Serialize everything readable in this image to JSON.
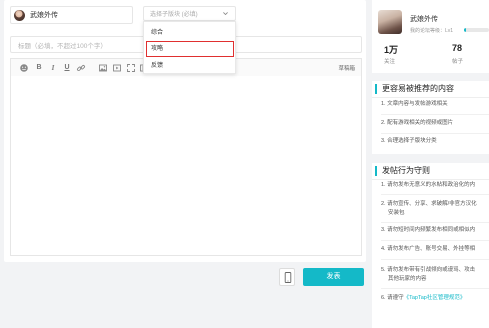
{
  "editor": {
    "forum_name": "武娘外传",
    "section_select": {
      "placeholder": "选择子版块 (必填)",
      "options": [
        "综合",
        "攻略",
        "反馈"
      ],
      "highlighted_option": "攻略"
    },
    "title_placeholder": "标题（必填，不超过100个字）",
    "toolbar": {
      "bold_label": "B",
      "italic_label": "I",
      "underline_label": "U",
      "draft_label": "草稿箱"
    },
    "publish_label": "发表"
  },
  "profile": {
    "name": "武娘外传",
    "level_text": "我的论坛等级：Lv1",
    "level_progress_percent": 8,
    "stats": [
      {
        "value": "1万",
        "label": "关注"
      },
      {
        "value": "78",
        "label": "帖子"
      }
    ]
  },
  "recommend": {
    "title": "更容易被推荐的内容",
    "tips": [
      "1. 文章内容与发帖游戏相关",
      "2. 配有游戏相关的视频或图片",
      "3. 合理选择子版块分类"
    ]
  },
  "rules": {
    "title": "发帖行为守则",
    "tips": [
      {
        "lines": [
          "1. 请勿发布无意义的水帖和政治化的内"
        ]
      },
      {
        "lines": [
          "2. 请勿宣传、分享、求破解/非官方汉化",
          "安装包"
        ]
      },
      {
        "lines": [
          "3. 请勿短时间内频繁发布相同或相似内"
        ]
      },
      {
        "lines": [
          "4. 请勿发布广告、账号交易、外挂等相"
        ]
      },
      {
        "lines": [
          "5. 请勿发布带有引战倾向或谩骂、攻击",
          "其他玩家的内容"
        ]
      }
    ],
    "final_prefix": "6. 请遵守",
    "final_link": "《TapTap社区管理规范》"
  },
  "colors": {
    "accent": "#14b9c8",
    "highlight_border": "#e02f2f",
    "background": "#f2f3f5"
  },
  "icons": [
    "chevron-down-icon",
    "emoji-icon",
    "link-icon",
    "image-icon",
    "video-icon",
    "mobile-icon"
  ]
}
